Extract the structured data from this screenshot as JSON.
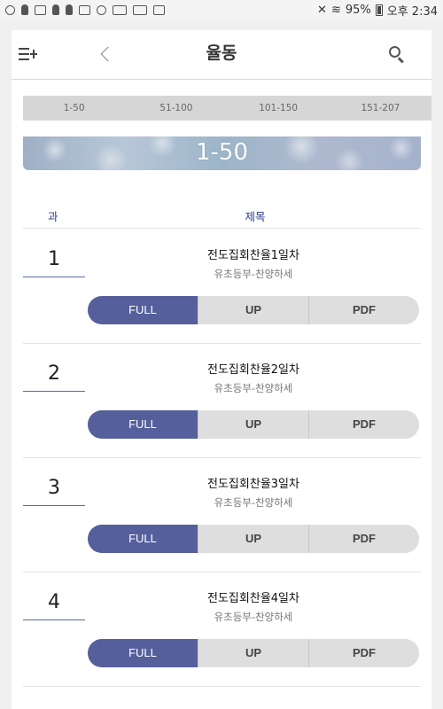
{
  "status_bar": {
    "battery": "95%",
    "time": "오후 2:34"
  },
  "header": {
    "title": "율동"
  },
  "range_tabs": [
    "1-50",
    "51-100",
    "101-150",
    "151-207"
  ],
  "banner": {
    "label": "1-50"
  },
  "columns": {
    "number": "과",
    "title": "제목"
  },
  "lessons": [
    {
      "number": "1",
      "title": "전도집회찬율1일차",
      "subtitle": "유초등부-찬양하세"
    },
    {
      "number": "2",
      "title": "전도집회찬율2일차",
      "subtitle": "유초등부-찬양하세"
    },
    {
      "number": "3",
      "title": "전도집회찬율3일차",
      "subtitle": "유초등부-찬양하세"
    },
    {
      "number": "4",
      "title": "전도집회찬율4일차",
      "subtitle": "유초등부-찬양하세"
    }
  ],
  "buttons": {
    "full": "FULL",
    "up": "UP",
    "pdf": "PDF"
  },
  "colors": {
    "accent": "#555f9c",
    "header_text": "#2c3d8f"
  }
}
